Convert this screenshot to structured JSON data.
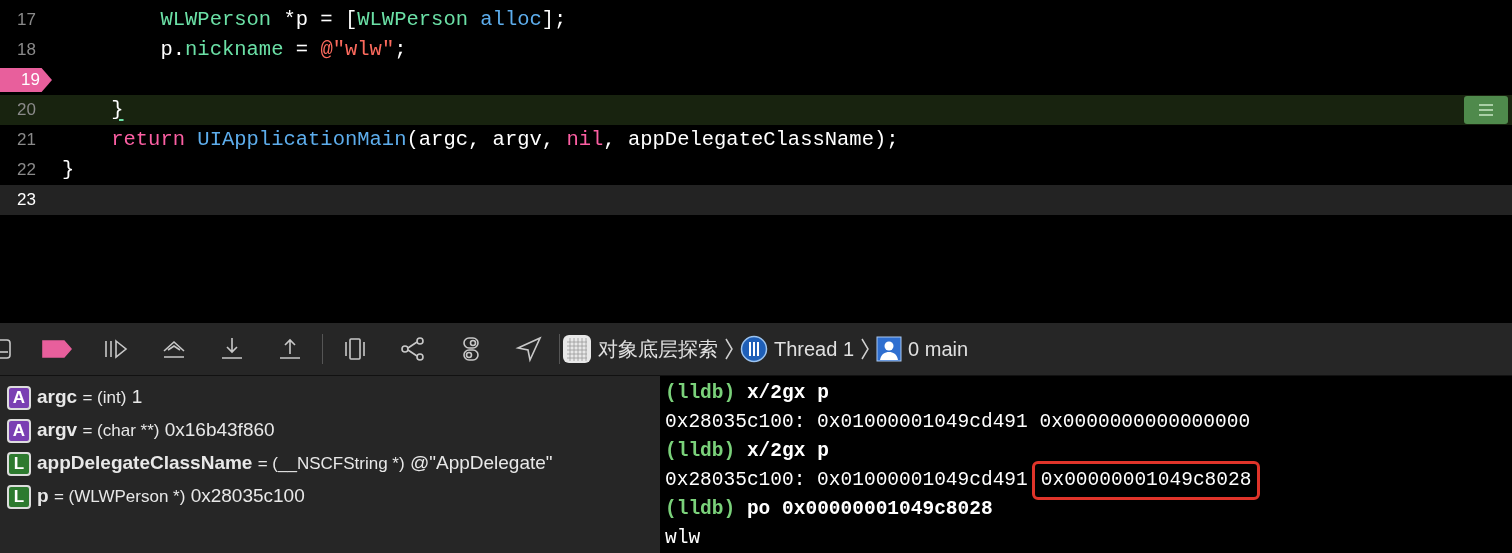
{
  "editor": {
    "lines": [
      {
        "number": "17",
        "kind": "normal",
        "tokens": [
          {
            "text": "        WLWPerson",
            "kind": "class"
          },
          {
            "text": " *p = [",
            "kind": "plain"
          },
          {
            "text": "WLWPerson",
            "kind": "class"
          },
          {
            "text": " alloc",
            "kind": "method"
          },
          {
            "text": "];",
            "kind": "plain"
          }
        ]
      },
      {
        "number": "18",
        "kind": "normal",
        "tokens": [
          {
            "text": "        p.",
            "kind": "plain"
          },
          {
            "text": "nickname",
            "kind": "class"
          },
          {
            "text": " = ",
            "kind": "plain"
          },
          {
            "text": "@\"wlw\"",
            "kind": "string"
          },
          {
            "text": ";",
            "kind": "plain"
          }
        ]
      },
      {
        "number": "19",
        "kind": "breakpoint"
      },
      {
        "number": "20",
        "kind": "current",
        "tokens": [
          {
            "text": "    }",
            "kind": "brace"
          }
        ]
      },
      {
        "number": "21",
        "kind": "normal",
        "tokens": [
          {
            "text": "    return",
            "kind": "keyword"
          },
          {
            "text": " UIApplicationMain",
            "kind": "method"
          },
          {
            "text": "(argc, argv, ",
            "kind": "plain"
          },
          {
            "text": "nil",
            "kind": "keyword"
          },
          {
            "text": ", appDelegateClassName);",
            "kind": "plain"
          }
        ]
      },
      {
        "number": "22",
        "kind": "normal",
        "tokens": [
          {
            "text": "}",
            "kind": "plain"
          }
        ]
      },
      {
        "number": "23",
        "kind": "cursor"
      }
    ]
  },
  "toolbar": {
    "breakpoints_active": true,
    "breadcrumbs": [
      {
        "kind": "app",
        "label": "对象底层探索"
      },
      {
        "kind": "thread",
        "label": "Thread 1"
      },
      {
        "kind": "frame",
        "label": "0 main"
      }
    ]
  },
  "variables": [
    {
      "kind": "argument",
      "badge": "A",
      "name": "argc",
      "type": "= (int)",
      "value": "1"
    },
    {
      "kind": "argument",
      "badge": "A",
      "name": "argv",
      "type": "= (char **)",
      "value": "0x16b43f860"
    },
    {
      "kind": "local",
      "badge": "L",
      "name": "appDelegateClassName",
      "type": "= (__NSCFString *)",
      "value": "@\"AppDelegate\""
    },
    {
      "kind": "local",
      "badge": "L",
      "name": "p",
      "type": "= (WLWPerson *)",
      "value": "0x28035c100"
    }
  ],
  "console": [
    {
      "kind": "command",
      "prompt": "(lldb)",
      "text": "x/2gx p"
    },
    {
      "kind": "output",
      "text": "0x28035c100: 0x01000001049cd491 0x0000000000000000"
    },
    {
      "kind": "command",
      "prompt": "(lldb)",
      "text": "x/2gx p"
    },
    {
      "kind": "output",
      "text": "0x28035c100: 0x01000001049cd491",
      "boxed": "0x00000001049c8028"
    },
    {
      "kind": "command",
      "prompt": "(lldb)",
      "text": "po 0x00000001049c8028"
    },
    {
      "kind": "output",
      "text": "wlw"
    }
  ]
}
